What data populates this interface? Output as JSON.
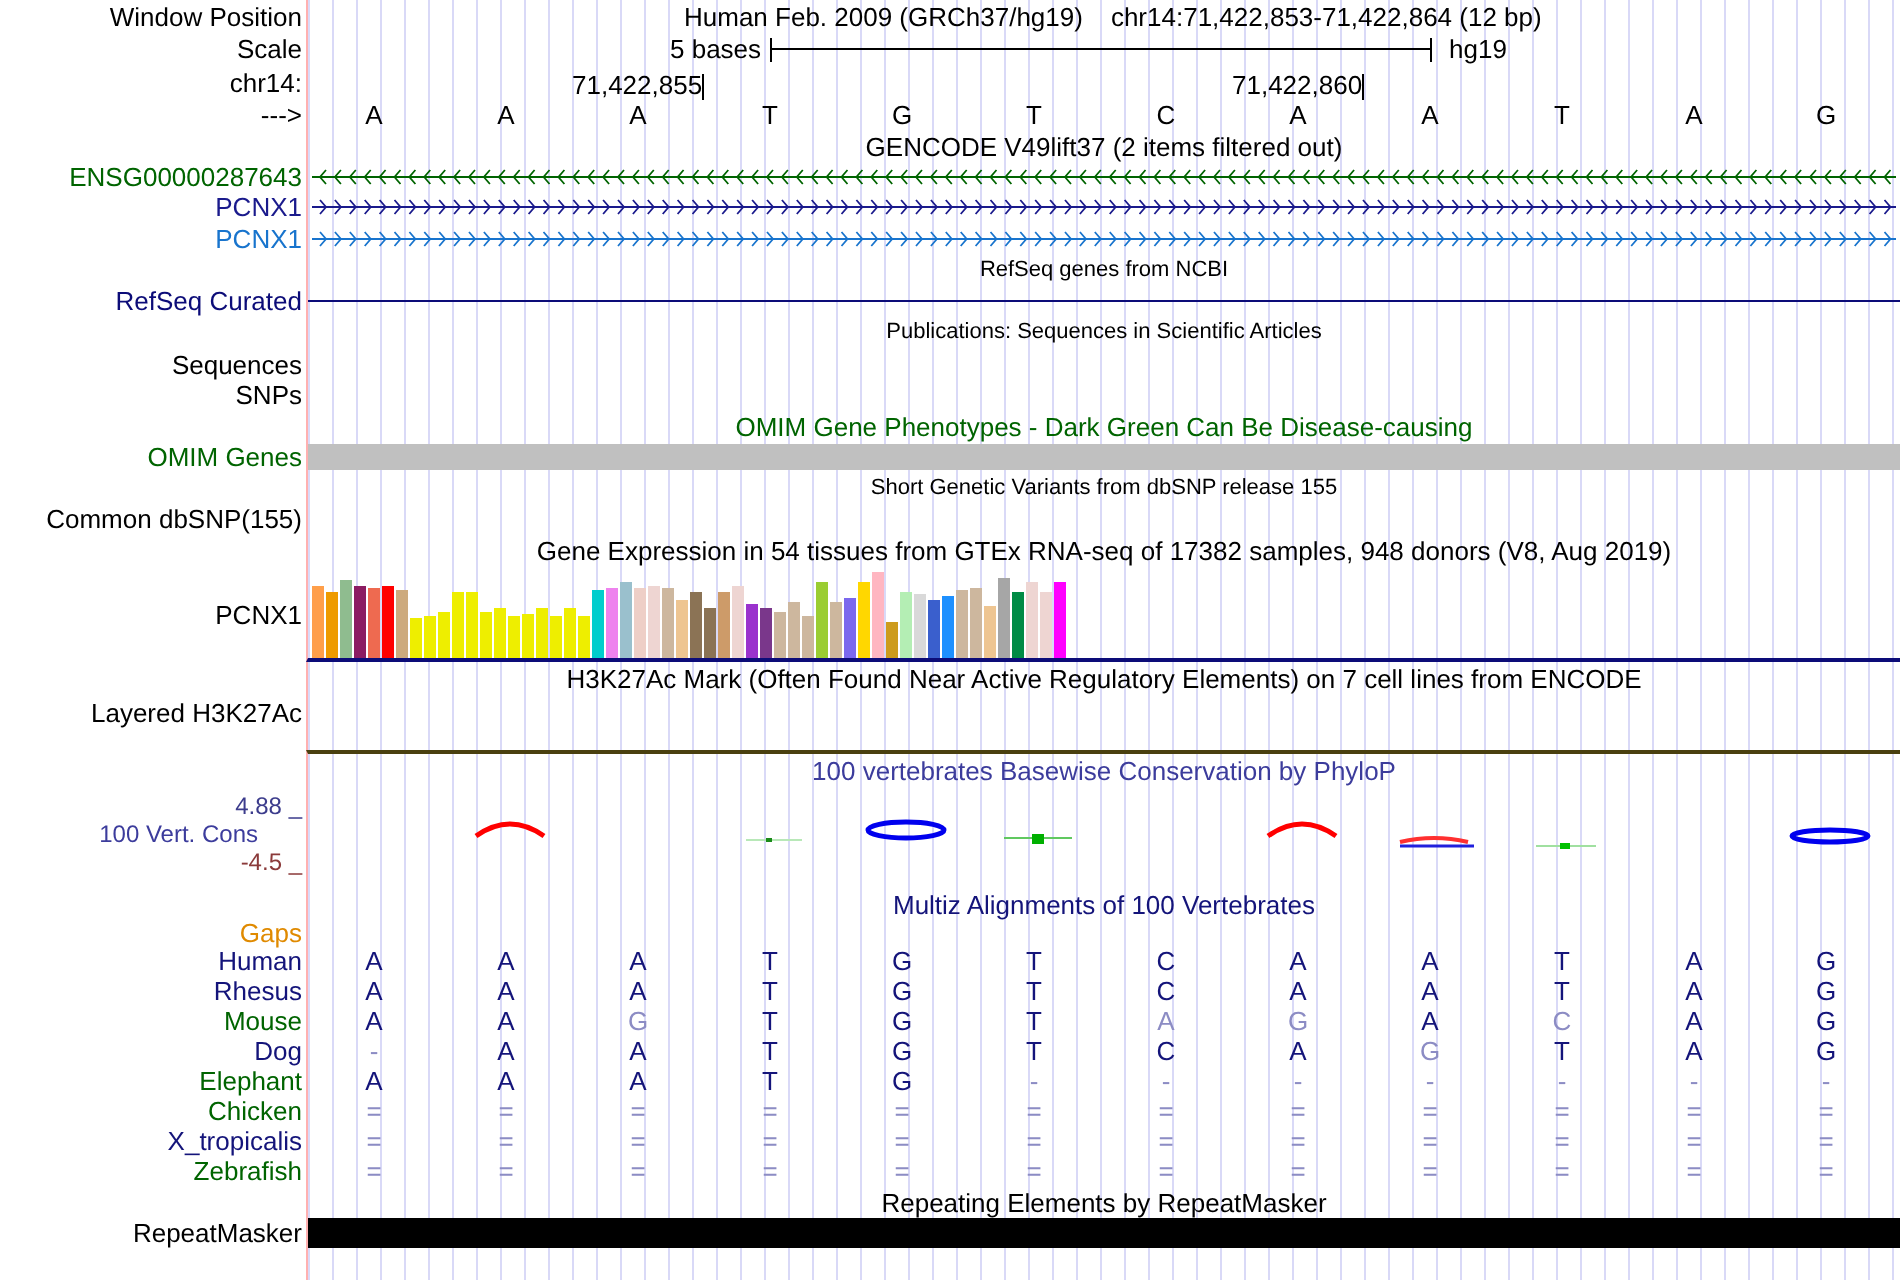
{
  "position": {
    "label": "Window Position",
    "assembly": "Human Feb. 2009 (GRCh37/hg19)",
    "range": "chr14:71,422,853-71,422,864 (12 bp)"
  },
  "scale": {
    "label": "Scale",
    "bar_label": "5 bases",
    "assembly": "hg19"
  },
  "ruler": {
    "label": "chr14:",
    "ticks": [
      "71,422,855",
      "71,422,860"
    ]
  },
  "sequence": {
    "label": "--->",
    "bases": [
      "A",
      "A",
      "A",
      "T",
      "G",
      "T",
      "C",
      "A",
      "A",
      "T",
      "A",
      "G"
    ]
  },
  "gencode": {
    "title": "GENCODE V49lift37 (2 items filtered out)",
    "items": [
      {
        "name": "ENSG00000287643",
        "reverse_strand": true,
        "color": "#006400"
      },
      {
        "name": "PCNX1",
        "reverse_strand": false,
        "color": "#1a1a8c"
      },
      {
        "name": "PCNX1",
        "reverse_strand": false,
        "color": "#1874cd"
      }
    ]
  },
  "refseq": {
    "title": "RefSeq genes from NCBI",
    "label": "RefSeq Curated"
  },
  "publications": {
    "title": "Publications: Sequences in Scientific Articles",
    "labels": [
      "Sequences",
      "SNPs"
    ]
  },
  "omim": {
    "title": "OMIM Gene Phenotypes - Dark Green Can Be Disease-causing",
    "label": "OMIM Genes"
  },
  "dbsnp": {
    "title": "Short Genetic Variants from dbSNP release 155",
    "label": "Common dbSNP(155)"
  },
  "gtex": {
    "title": "Gene Expression in 54 tissues from GTEx RNA-seq of 17382 samples, 948 donors (V8, Aug 2019)",
    "label": "PCNX1"
  },
  "h3k27ac": {
    "title": "H3K27Ac Mark (Often Found Near Active Regulatory Elements) on 7 cell lines from ENCODE",
    "label": "Layered H3K27Ac"
  },
  "phylop": {
    "title": "100 vertebrates Basewise Conservation by PhyloP",
    "label": "100 Vert. Cons",
    "max_label": "4.88 _",
    "min_label": "-4.5 _"
  },
  "multiz": {
    "title": "Multiz Alignments of 100 Vertebrates",
    "gaps_label": "Gaps",
    "species": [
      {
        "name": "Human",
        "color": "#14147a",
        "bases": [
          {
            "b": "A",
            "dim": false
          },
          {
            "b": "A",
            "dim": false
          },
          {
            "b": "A",
            "dim": false
          },
          {
            "b": "T",
            "dim": false
          },
          {
            "b": "G",
            "dim": false
          },
          {
            "b": "T",
            "dim": false
          },
          {
            "b": "C",
            "dim": false
          },
          {
            "b": "A",
            "dim": false
          },
          {
            "b": "A",
            "dim": false
          },
          {
            "b": "T",
            "dim": false
          },
          {
            "b": "A",
            "dim": false
          },
          {
            "b": "G",
            "dim": false
          }
        ]
      },
      {
        "name": "Rhesus",
        "color": "#14147a",
        "bases": [
          {
            "b": "A",
            "dim": false
          },
          {
            "b": "A",
            "dim": false
          },
          {
            "b": "A",
            "dim": false
          },
          {
            "b": "T",
            "dim": false
          },
          {
            "b": "G",
            "dim": false
          },
          {
            "b": "T",
            "dim": false
          },
          {
            "b": "C",
            "dim": false
          },
          {
            "b": "A",
            "dim": false
          },
          {
            "b": "A",
            "dim": false
          },
          {
            "b": "T",
            "dim": false
          },
          {
            "b": "A",
            "dim": false
          },
          {
            "b": "G",
            "dim": false
          }
        ]
      },
      {
        "name": "Mouse",
        "color": "#006400",
        "bases": [
          {
            "b": "A",
            "dim": false
          },
          {
            "b": "A",
            "dim": false
          },
          {
            "b": "G",
            "dim": true
          },
          {
            "b": "T",
            "dim": false
          },
          {
            "b": "G",
            "dim": false
          },
          {
            "b": "T",
            "dim": false
          },
          {
            "b": "A",
            "dim": true
          },
          {
            "b": "G",
            "dim": true
          },
          {
            "b": "A",
            "dim": false
          },
          {
            "b": "C",
            "dim": true
          },
          {
            "b": "A",
            "dim": false
          },
          {
            "b": "G",
            "dim": false
          }
        ]
      },
      {
        "name": "Dog",
        "color": "#14147a",
        "bases": [
          {
            "b": "-",
            "dim": true
          },
          {
            "b": "A",
            "dim": false
          },
          {
            "b": "A",
            "dim": false
          },
          {
            "b": "T",
            "dim": false
          },
          {
            "b": "G",
            "dim": false
          },
          {
            "b": "T",
            "dim": false
          },
          {
            "b": "C",
            "dim": false
          },
          {
            "b": "A",
            "dim": false
          },
          {
            "b": "G",
            "dim": true
          },
          {
            "b": "T",
            "dim": false
          },
          {
            "b": "A",
            "dim": false
          },
          {
            "b": "G",
            "dim": false
          }
        ]
      },
      {
        "name": "Elephant",
        "color": "#006400",
        "bases": [
          {
            "b": "A",
            "dim": false
          },
          {
            "b": "A",
            "dim": false
          },
          {
            "b": "A",
            "dim": false
          },
          {
            "b": "T",
            "dim": false
          },
          {
            "b": "G",
            "dim": false
          },
          {
            "b": "-",
            "dim": true
          },
          {
            "b": "-",
            "dim": true
          },
          {
            "b": "-",
            "dim": true
          },
          {
            "b": "-",
            "dim": true
          },
          {
            "b": "-",
            "dim": true
          },
          {
            "b": "-",
            "dim": true
          },
          {
            "b": "-",
            "dim": true
          }
        ]
      },
      {
        "name": "Chicken",
        "color": "#006400",
        "bases": [
          {
            "b": "=",
            "dim": true
          },
          {
            "b": "=",
            "dim": true
          },
          {
            "b": "=",
            "dim": true
          },
          {
            "b": "=",
            "dim": true
          },
          {
            "b": "=",
            "dim": true
          },
          {
            "b": "=",
            "dim": true
          },
          {
            "b": "=",
            "dim": true
          },
          {
            "b": "=",
            "dim": true
          },
          {
            "b": "=",
            "dim": true
          },
          {
            "b": "=",
            "dim": true
          },
          {
            "b": "=",
            "dim": true
          },
          {
            "b": "=",
            "dim": true
          }
        ]
      },
      {
        "name": "X_tropicalis",
        "color": "#14147a",
        "bases": [
          {
            "b": "=",
            "dim": true
          },
          {
            "b": "=",
            "dim": true
          },
          {
            "b": "=",
            "dim": true
          },
          {
            "b": "=",
            "dim": true
          },
          {
            "b": "=",
            "dim": true
          },
          {
            "b": "=",
            "dim": true
          },
          {
            "b": "=",
            "dim": true
          },
          {
            "b": "=",
            "dim": true
          },
          {
            "b": "=",
            "dim": true
          },
          {
            "b": "=",
            "dim": true
          },
          {
            "b": "=",
            "dim": true
          },
          {
            "b": "=",
            "dim": true
          }
        ]
      },
      {
        "name": "Zebrafish",
        "color": "#006400",
        "bases": [
          {
            "b": "=",
            "dim": true
          },
          {
            "b": "=",
            "dim": true
          },
          {
            "b": "=",
            "dim": true
          },
          {
            "b": "=",
            "dim": true
          },
          {
            "b": "=",
            "dim": true
          },
          {
            "b": "=",
            "dim": true
          },
          {
            "b": "=",
            "dim": true
          },
          {
            "b": "=",
            "dim": true
          },
          {
            "b": "=",
            "dim": true
          },
          {
            "b": "=",
            "dim": true
          },
          {
            "b": "=",
            "dim": true
          },
          {
            "b": "=",
            "dim": true
          }
        ]
      }
    ]
  },
  "repeatmasker": {
    "title": "Repeating Elements by RepeatMasker",
    "label": "RepeatMasker"
  }
}
